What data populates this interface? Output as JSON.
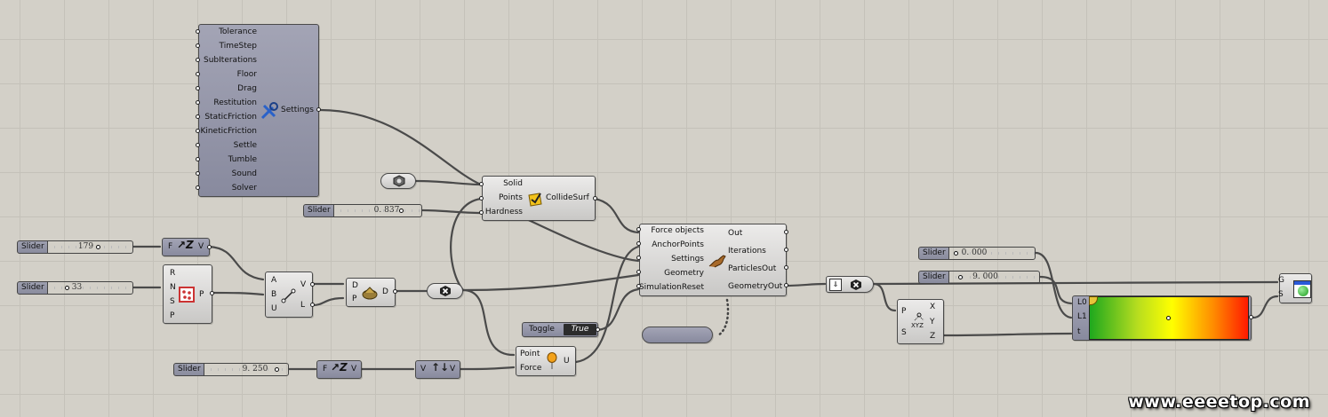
{
  "settings_component": {
    "inputs": [
      "Tolerance",
      "TimeStep",
      "SubIterations",
      "Floor",
      "Drag",
      "Restitution",
      "StaticFriction",
      "KineticFriction",
      "Settle",
      "Tumble",
      "Sound",
      "Solver"
    ],
    "output": "Settings"
  },
  "collide_component": {
    "inputs": [
      "Solid",
      "Points",
      "Hardness"
    ],
    "output": "CollideSurf"
  },
  "hardness_slider": {
    "name": "Slider",
    "value": "0. 837"
  },
  "slider_179": {
    "name": "Slider",
    "value": "179"
  },
  "slider_33": {
    "name": "Slider",
    "value": "33"
  },
  "slider_9250": {
    "name": "Slider",
    "value": "9. 250"
  },
  "fz_top": {
    "input": "F",
    "output": "V"
  },
  "fz_bottom": {
    "input": "F",
    "output": "V"
  },
  "rnsp": {
    "inputs": [
      "R",
      "N",
      "S",
      "P"
    ],
    "output": "P"
  },
  "vector2pt": {
    "inputs": [
      "A",
      "B",
      "U"
    ],
    "outputs": [
      "V",
      "L"
    ]
  },
  "dp": {
    "inputs": [
      "D",
      "P"
    ],
    "output": "D"
  },
  "kangaroo": {
    "inputs": [
      "Force objects",
      "AnchorPoints",
      "Settings",
      "Geometry",
      "SimulationReset"
    ],
    "outputs": [
      "Out",
      "Iterations",
      "ParticlesOut",
      "GeometryOut"
    ]
  },
  "toggle": {
    "name": "Toggle",
    "value": "True"
  },
  "unary_force": {
    "inputs": [
      "Point",
      "Force"
    ],
    "output": "U"
  },
  "vector_v": {
    "input": "V",
    "output": "V"
  },
  "slider_0": {
    "name": "Slider",
    "value": "0. 000"
  },
  "slider_9": {
    "name": "Slider",
    "value": "9. 000"
  },
  "pxyz": {
    "inputs": [
      "P",
      "S"
    ],
    "outputs": [
      "X",
      "Y",
      "Z"
    ],
    "icon_text": "XYZ"
  },
  "gradient": {
    "inputs": [
      "L0",
      "L1",
      "t"
    ]
  },
  "preview": {
    "inputs": [
      "G",
      "S"
    ]
  },
  "watermark": "www.eeeetop.com",
  "colors": {
    "canvas": "#d3d0c8",
    "grid": "#c4c1b9",
    "wire": "#4a4a4a",
    "dark_component": "#9a9cae",
    "light_component": "#e2e1df"
  }
}
